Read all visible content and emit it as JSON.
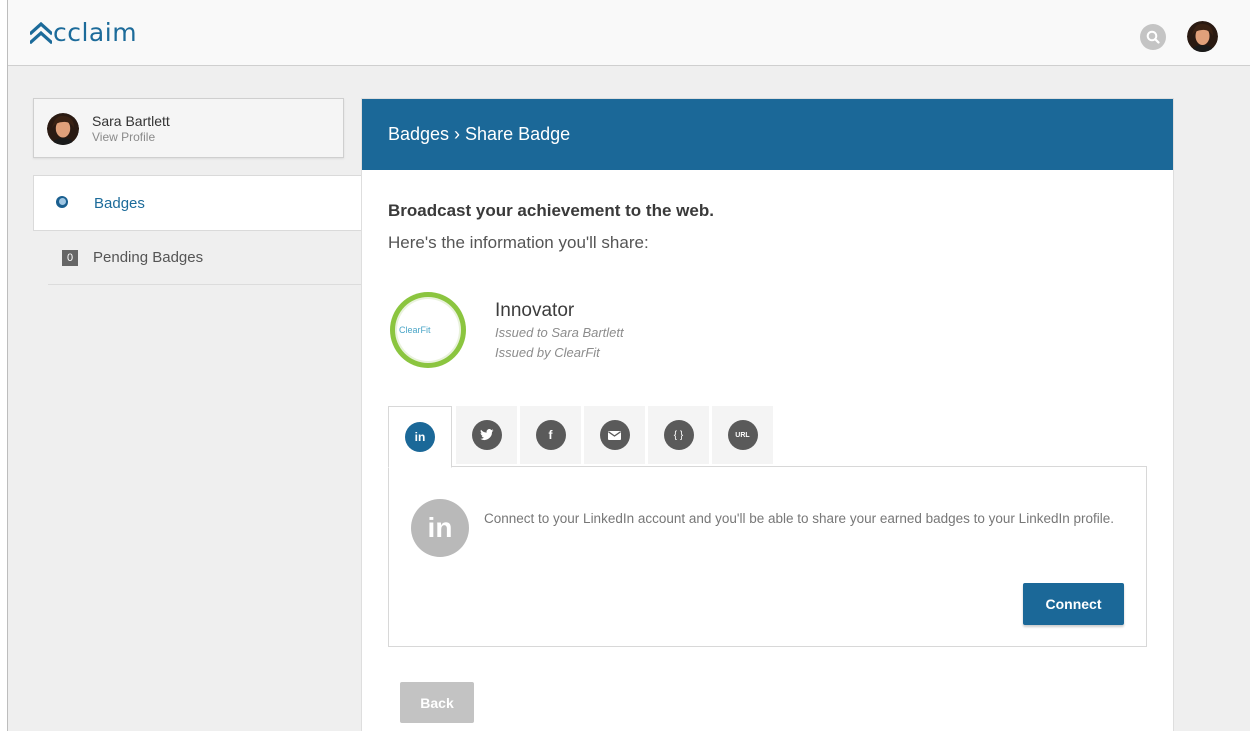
{
  "header": {
    "logo_text": "cclaim",
    "brand_color": "#1c6b9a",
    "search_icon": "search-icon",
    "avatar_icon": "user-avatar"
  },
  "sidebar": {
    "profile": {
      "name": "Sara Bartlett",
      "link": "View Profile"
    },
    "items": [
      {
        "label": "Badges",
        "icon": "badge-icon",
        "active": true
      },
      {
        "label": "Pending Badges",
        "count": "0",
        "active": false
      }
    ]
  },
  "main": {
    "header": "Badges › Share Badge",
    "header_color": "#1b6898",
    "lead": "Broadcast your achievement to the web.",
    "sub": "Here's the information you'll share:",
    "badge": {
      "logo_text": "ClearFit",
      "title": "Innovator",
      "issued_to": "Issued to Sara Bartlett",
      "issued_by": "Issued by ClearFit"
    },
    "share_tabs": [
      {
        "name": "linkedin",
        "icon": "linkedin-icon",
        "glyph": "in",
        "active": true
      },
      {
        "name": "twitter",
        "icon": "twitter-icon",
        "glyph": "t"
      },
      {
        "name": "facebook",
        "icon": "facebook-icon",
        "glyph": "f"
      },
      {
        "name": "email",
        "icon": "email-icon",
        "glyph": "✉"
      },
      {
        "name": "embed",
        "icon": "embed-code-icon",
        "glyph": "{ }"
      },
      {
        "name": "url",
        "icon": "url-icon",
        "glyph": "URL"
      }
    ],
    "linkedin": {
      "glyph": "in",
      "text": "Connect to your LinkedIn account and you'll be able to share your earned badges to your LinkedIn profile.",
      "connect_label": "Connect"
    },
    "back_label": "Back"
  }
}
